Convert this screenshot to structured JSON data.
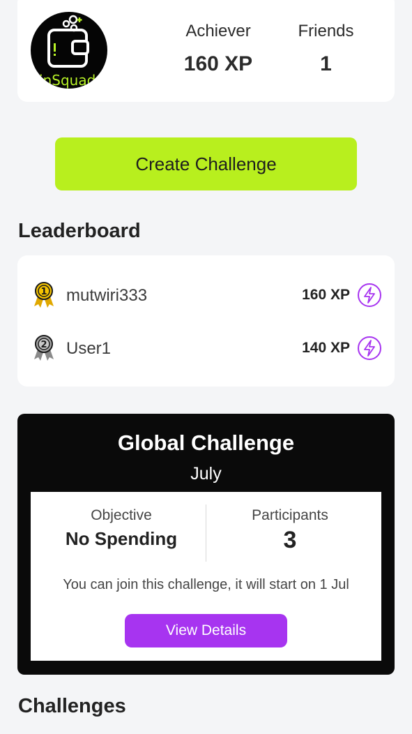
{
  "profile": {
    "avatar_text": "FinSquad",
    "level_label": "Achiever",
    "xp_value": "160 XP",
    "friends_label": "Friends",
    "friends_value": "1"
  },
  "actions": {
    "create_challenge_label": "Create Challenge"
  },
  "leaderboard": {
    "title": "Leaderboard",
    "rows": [
      {
        "rank": "1",
        "name": "mutwiri333",
        "xp": "160 XP",
        "medal": "gold-medal-icon"
      },
      {
        "rank": "2",
        "name": "User1",
        "xp": "140 XP",
        "medal": "silver-medal-icon"
      }
    ]
  },
  "global_challenge": {
    "title": "Global Challenge",
    "month": "July",
    "objective_label": "Objective",
    "objective_value": "No Spending",
    "participants_label": "Participants",
    "participants_value": "3",
    "join_text": "You can join this challenge, it will start on 1 Jul",
    "details_label": "View Details"
  },
  "challenges": {
    "title": "Challenges"
  },
  "colors": {
    "accent_green": "#b8ef1e",
    "accent_purple": "#a734f0",
    "gold": "#f2c200",
    "silver": "#8a8a8a"
  }
}
